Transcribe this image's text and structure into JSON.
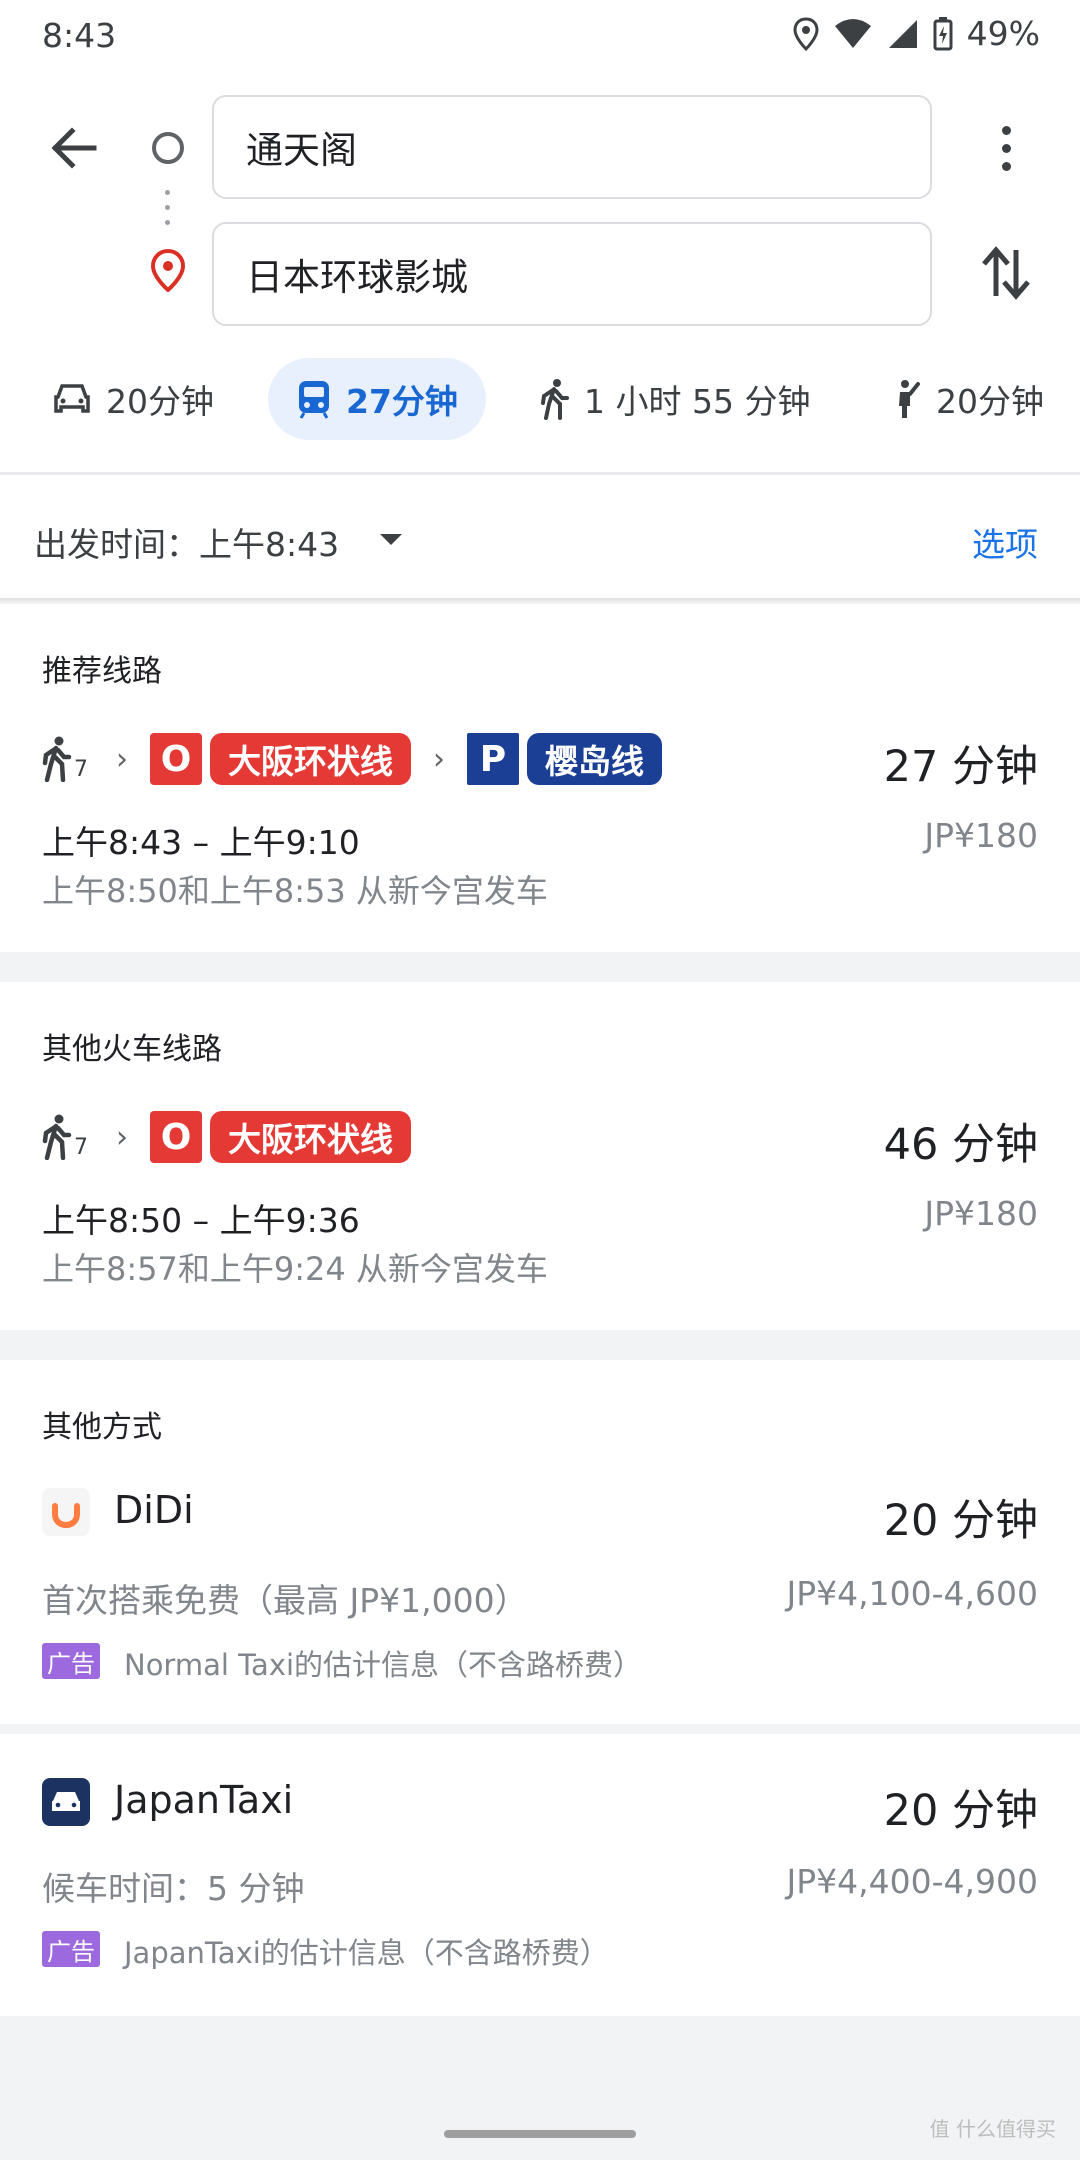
{
  "status_bar": {
    "time": "8:43",
    "battery": "49%"
  },
  "search": {
    "origin": "通天阁",
    "destination": "日本环球影城"
  },
  "modes": [
    {
      "label": "20分钟",
      "icon": "car-icon"
    },
    {
      "label": "27分钟",
      "icon": "transit-icon",
      "active": true
    },
    {
      "label": "1 小时 55 分钟",
      "icon": "walk-icon"
    },
    {
      "label": "20分钟",
      "icon": "ride-hail-icon"
    }
  ],
  "depart": {
    "label": "出发时间：上午8:43",
    "options": "选项"
  },
  "recommended": {
    "title": "推荐线路",
    "walk_minutes": "7",
    "line1": {
      "letter": "O",
      "name": "大阪环状线"
    },
    "line2": {
      "letter": "P",
      "name": "樱岛线"
    },
    "duration": "27 分钟",
    "time_range": "上午8:43 – 上午9:10",
    "fare": "JP¥180",
    "departures": "上午8:50和上午8:53 从新今宫发车"
  },
  "other_train": {
    "title": "其他火车线路",
    "walk_minutes": "7",
    "line1": {
      "letter": "O",
      "name": "大阪环状线"
    },
    "duration": "46 分钟",
    "time_range": "上午8:50 – 上午9:36",
    "fare": "JP¥180",
    "departures": "上午8:57和上午9:24 从新今宫发车"
  },
  "other_ways": {
    "title": "其他方式",
    "didi": {
      "name": "DiDi",
      "duration": "20 分钟",
      "promo": "首次搭乘免费（最高 JP¥1,000）",
      "fare": "JP¥4,100-4,600",
      "ad_badge": "广告",
      "ad_text": "Normal Taxi的估计信息（不含路桥费）"
    },
    "japantaxi": {
      "name": "JapanTaxi",
      "duration": "20 分钟",
      "wait": "候车时间：5 分钟",
      "fare": "JP¥4,400-4,900",
      "ad_badge": "广告",
      "ad_text": "JapanTaxi的估计信息（不含路桥费）"
    }
  },
  "watermark": "值 什么值得买",
  "colors": {
    "accent": "#1a73e8",
    "osaka_loop": "#e53935",
    "sakurajima": "#1a3f94",
    "ad": "#9c6ade"
  }
}
